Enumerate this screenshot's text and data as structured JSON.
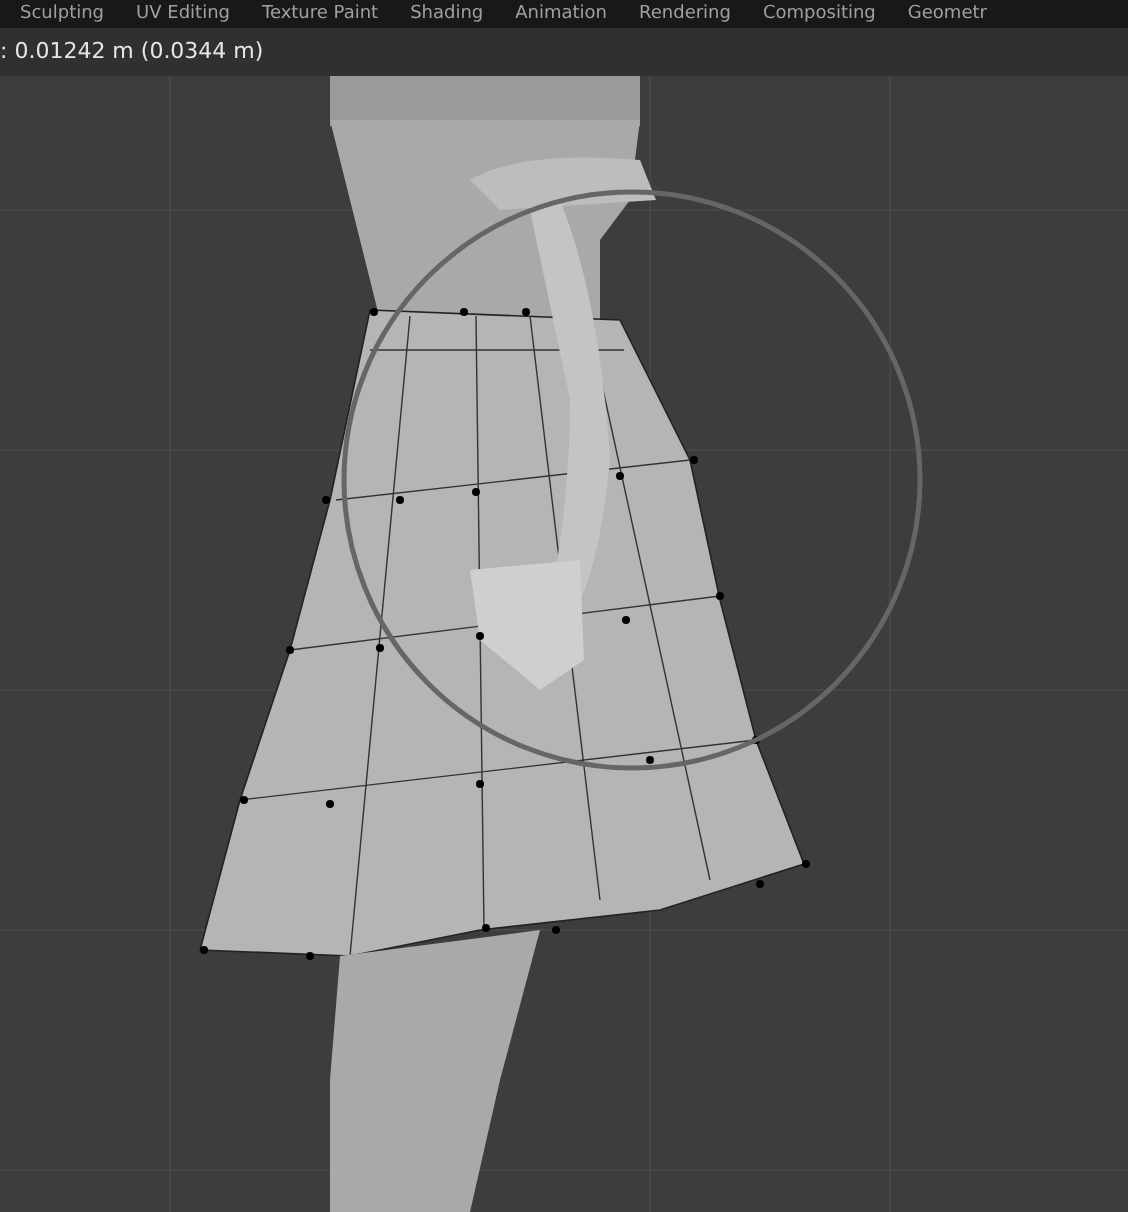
{
  "workspace_tabs": [
    {
      "label": "Sculpting"
    },
    {
      "label": "UV Editing"
    },
    {
      "label": "Texture Paint"
    },
    {
      "label": "Shading"
    },
    {
      "label": "Animation"
    },
    {
      "label": "Rendering"
    },
    {
      "label": "Compositing"
    },
    {
      "label": "Geometr"
    }
  ],
  "header": {
    "operator_info": ": 0.01242 m (0.0344 m)"
  }
}
